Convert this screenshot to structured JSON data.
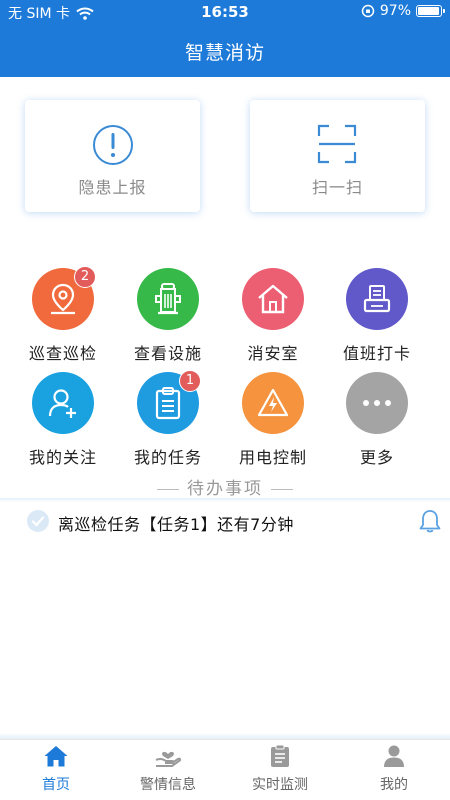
{
  "status": {
    "carrier": "无 SIM 卡",
    "time": "16:53",
    "battery": "97%",
    "battery_level": 0.97
  },
  "header": {
    "title": "智慧消访"
  },
  "cards": [
    {
      "label": "隐患上报",
      "icon": "exclamation-circle-icon"
    },
    {
      "label": "扫一扫",
      "icon": "scan-icon"
    }
  ],
  "grid": [
    {
      "label": "巡查巡检",
      "icon": "location-pin-icon",
      "color": "#f06a3d",
      "badge": "2"
    },
    {
      "label": "查看设施",
      "icon": "fire-hydrant-icon",
      "color": "#37b94a",
      "badge": ""
    },
    {
      "label": "消安室",
      "icon": "home-icon",
      "color": "#ec5f73",
      "badge": ""
    },
    {
      "label": "值班打卡",
      "icon": "clock-in-icon",
      "color": "#6159c9",
      "badge": ""
    },
    {
      "label": "我的关注",
      "icon": "user-add-icon",
      "color": "#1aa2e0",
      "badge": ""
    },
    {
      "label": "我的任务",
      "icon": "clipboard-icon",
      "color": "#1f9be0",
      "badge": "1"
    },
    {
      "label": "用电控制",
      "icon": "electric-warning-icon",
      "color": "#f5933f",
      "badge": ""
    },
    {
      "label": "更多",
      "icon": "more-icon",
      "color": "#a4a4a4",
      "badge": ""
    }
  ],
  "todo": {
    "title": "待办事项",
    "items": [
      {
        "text": "离巡检任务【任务1】还有7分钟"
      }
    ]
  },
  "tabs": [
    {
      "label": "首页",
      "icon": "home-icon",
      "active": true
    },
    {
      "label": "警情信息",
      "icon": "alert-hand-icon",
      "active": false
    },
    {
      "label": "实时监测",
      "icon": "monitor-clipboard-icon",
      "active": false
    },
    {
      "label": "我的",
      "icon": "user-icon",
      "active": false
    }
  ],
  "colors": {
    "primary": "#1e7ad8",
    "badge": "#e35c5c",
    "inactive_tab": "#9a9a9a"
  }
}
